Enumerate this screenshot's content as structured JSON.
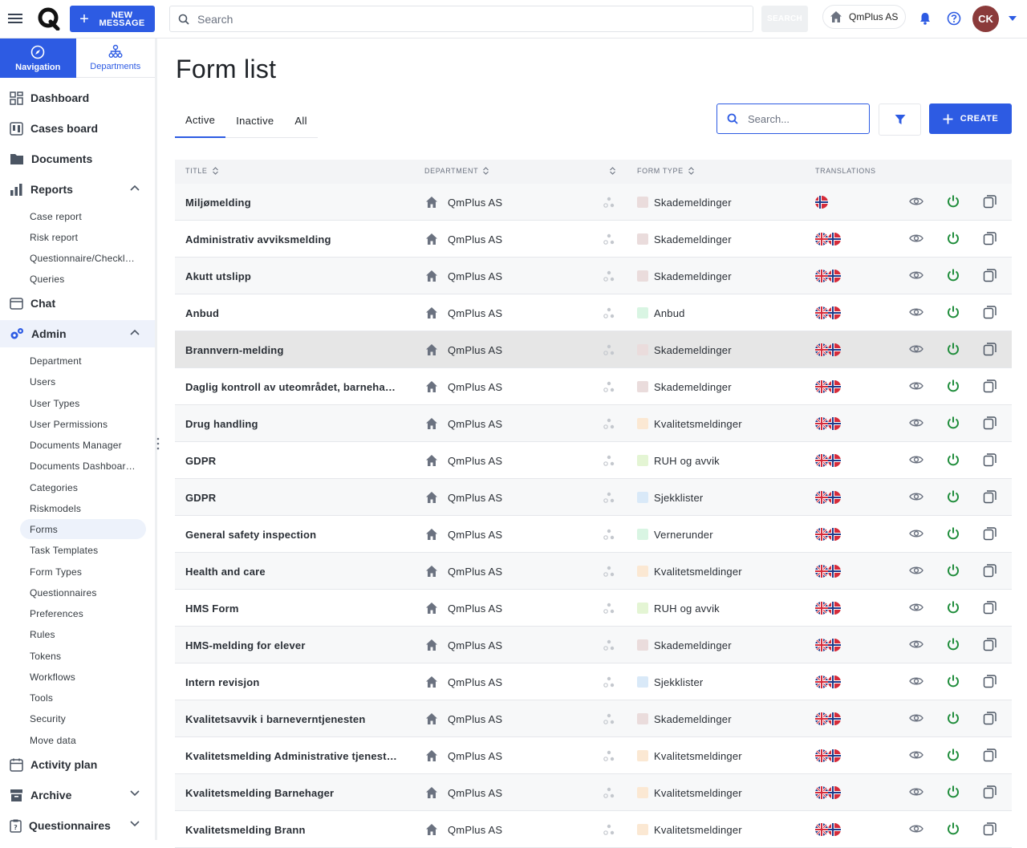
{
  "topbar": {
    "new_message_label": "NEW MESSAGE",
    "search_placeholder": "Search",
    "search_button": "SEARCH",
    "org_name": "QmPlus AS",
    "avatar_initials": "CK"
  },
  "colors": {
    "primary": "#2d5be3",
    "power_green": "#1e8c3a",
    "avatar": "#8b3a3a"
  },
  "sidebar": {
    "tabs": [
      {
        "label": "Navigation",
        "icon": "compass-icon",
        "active": true
      },
      {
        "label": "Departments",
        "icon": "org-chart-icon",
        "active": false
      }
    ],
    "items": [
      {
        "label": "Dashboard",
        "icon": "grid-icon"
      },
      {
        "label": "Cases board",
        "icon": "board-icon"
      },
      {
        "label": "Documents",
        "icon": "folder-icon"
      },
      {
        "label": "Reports",
        "icon": "bar-chart-icon",
        "expanded": true,
        "children": [
          "Case report",
          "Risk report",
          "Questionnaire/Checkl…",
          "Queries"
        ]
      },
      {
        "label": "Chat",
        "icon": "chat-icon"
      },
      {
        "label": "Admin",
        "icon": "gears-icon",
        "expanded": true,
        "children": [
          "Department",
          "Users",
          "User Types",
          "User Permissions",
          "Documents Manager",
          "Documents Dashboar…",
          "Categories",
          "Riskmodels",
          "Forms",
          "Task Templates",
          "Form Types",
          "Questionnaires",
          "Preferences",
          "Rules",
          "Tokens",
          "Workflows",
          "Tools",
          "Security",
          "Move data"
        ],
        "selected": "Forms"
      },
      {
        "label": "Activity plan",
        "icon": "calendar-icon"
      },
      {
        "label": "Archive",
        "icon": "archive-icon",
        "expanded": false
      },
      {
        "label": "Questionnaires",
        "icon": "clipboard-icon",
        "expanded": false
      }
    ]
  },
  "main": {
    "title": "Form list",
    "tabs": [
      "Active",
      "Inactive",
      "All"
    ],
    "active_tab": "Active",
    "search_placeholder": "Search...",
    "create_label": "CREATE",
    "columns": {
      "title": "TITLE",
      "department": "DEPARTMENT",
      "form_type": "FORM TYPE",
      "translations": "TRANSLATIONS"
    },
    "form_type_colors": {
      "Skademeldinger": "#eadcdc",
      "Anbud": "#d9f5e3",
      "Kvalitetsmeldinger": "#fbe8d3",
      "RUH og avvik": "#e4f5d4",
      "Sjekklister": "#d9e9f8",
      "Vernerunder": "#d9f5e3"
    },
    "rows": [
      {
        "title": "Miljømelding",
        "department": "QmPlus AS",
        "form_type": "Skademeldinger",
        "translations": [
          "no"
        ]
      },
      {
        "title": "Administrativ avviksmelding",
        "department": "QmPlus AS",
        "form_type": "Skademeldinger",
        "translations": [
          "gb",
          "no"
        ]
      },
      {
        "title": "Akutt utslipp",
        "department": "QmPlus AS",
        "form_type": "Skademeldinger",
        "translations": [
          "gb",
          "no"
        ]
      },
      {
        "title": "Anbud",
        "department": "QmPlus AS",
        "form_type": "Anbud",
        "translations": [
          "gb",
          "no"
        ]
      },
      {
        "title": "Brannvern-melding",
        "department": "QmPlus AS",
        "form_type": "Skademeldinger",
        "translations": [
          "gb",
          "no"
        ],
        "hover": true
      },
      {
        "title": "Daglig kontroll av uteområdet, barneha…",
        "department": "QmPlus AS",
        "form_type": "Skademeldinger",
        "translations": [
          "gb",
          "no"
        ]
      },
      {
        "title": "Drug handling",
        "department": "QmPlus AS",
        "form_type": "Kvalitetsmeldinger",
        "translations": [
          "gb",
          "no"
        ]
      },
      {
        "title": "GDPR",
        "department": "QmPlus AS",
        "form_type": "RUH og avvik",
        "translations": [
          "gb",
          "no"
        ]
      },
      {
        "title": "GDPR",
        "department": "QmPlus AS",
        "form_type": "Sjekklister",
        "translations": [
          "gb",
          "no"
        ]
      },
      {
        "title": "General safety inspection",
        "department": "QmPlus AS",
        "form_type": "Vernerunder",
        "translations": [
          "gb",
          "no"
        ]
      },
      {
        "title": "Health and care",
        "department": "QmPlus AS",
        "form_type": "Kvalitetsmeldinger",
        "translations": [
          "gb",
          "no"
        ]
      },
      {
        "title": "HMS Form",
        "department": "QmPlus AS",
        "form_type": "RUH og avvik",
        "translations": [
          "gb",
          "no"
        ]
      },
      {
        "title": "HMS-melding for elever",
        "department": "QmPlus AS",
        "form_type": "Skademeldinger",
        "translations": [
          "gb",
          "no"
        ]
      },
      {
        "title": "Intern revisjon",
        "department": "QmPlus AS",
        "form_type": "Sjekklister",
        "translations": [
          "gb",
          "no"
        ]
      },
      {
        "title": "Kvalitetsavvik i barneverntjenesten",
        "department": "QmPlus AS",
        "form_type": "Skademeldinger",
        "translations": [
          "gb",
          "no"
        ]
      },
      {
        "title": "Kvalitetsmelding Administrative tjenest…",
        "department": "QmPlus AS",
        "form_type": "Kvalitetsmeldinger",
        "translations": [
          "gb",
          "no"
        ]
      },
      {
        "title": "Kvalitetsmelding Barnehager",
        "department": "QmPlus AS",
        "form_type": "Kvalitetsmeldinger",
        "translations": [
          "gb",
          "no"
        ]
      },
      {
        "title": "Kvalitetsmelding Brann",
        "department": "QmPlus AS",
        "form_type": "Kvalitetsmeldinger",
        "translations": [
          "gb",
          "no"
        ]
      }
    ]
  }
}
